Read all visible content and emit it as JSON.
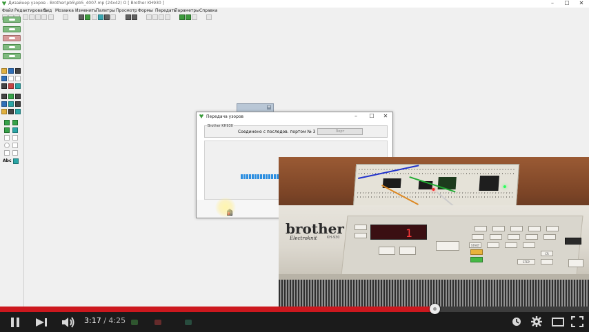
{
  "app": {
    "title": "Дизайнер узоров - Brother\\pb5\\pb5_4007.mp (24x42) O       [ Brother KH930 ]",
    "window_controls": [
      "–",
      "☐",
      "✕"
    ]
  },
  "menu": [
    "Файл",
    "Редактировать",
    "Вид",
    "Мозаика",
    "Изменить",
    "Палитры",
    "Просмотр",
    "Формы",
    "Передать",
    "Параметры",
    "Справка"
  ],
  "left_panel": {
    "text_tool": "Abc"
  },
  "dialog": {
    "title": "Передача узоров",
    "group_label": "Brother KH930",
    "status": "Соединено с последов. портом № 3",
    "button": "Порт",
    "progress_segments": 16,
    "controls": [
      "–",
      "☐",
      "✕"
    ]
  },
  "video": {
    "brand": "brother",
    "brand_sub": "Electroknit",
    "model": "KH-930",
    "display_digit": "1",
    "buttons": {
      "start": "START",
      "step": "STEP",
      "cr": "CR"
    }
  },
  "player": {
    "current_time": "3:17",
    "separator": "/",
    "duration": "4:25",
    "progress": 0.738,
    "colors": {
      "progress": "#cc181e",
      "bar": "#1b1b1b"
    }
  }
}
